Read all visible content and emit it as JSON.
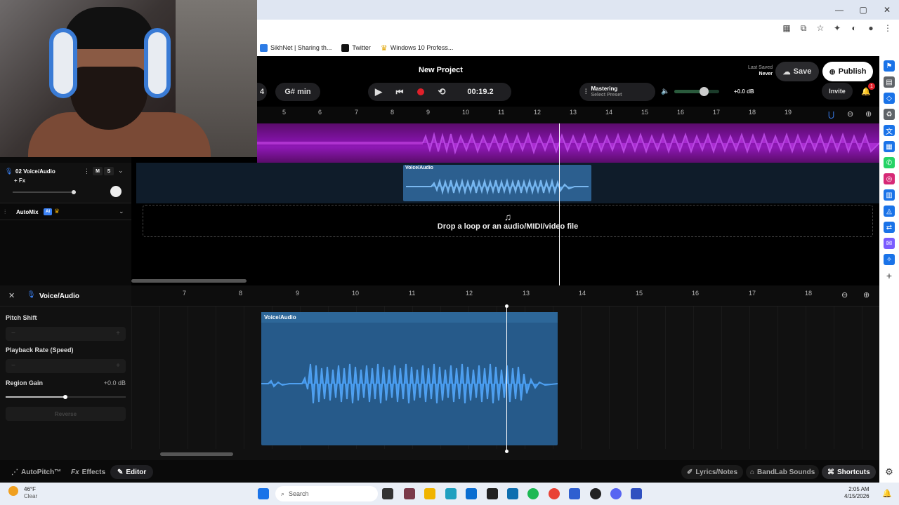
{
  "browser": {
    "window_controls": [
      "—",
      "▢",
      "✕"
    ],
    "bookmarks": [
      {
        "label": "SikhNet | Sharing th...",
        "icon": "sikhnet-icon",
        "color": "#2c7be5"
      },
      {
        "label": "Twitter",
        "icon": "x-twitter-icon",
        "color": "#111111"
      },
      {
        "label": "Windows 10 Profess...",
        "icon": "crown-icon",
        "color": "#e0a400"
      }
    ]
  },
  "toolbar": {
    "project_title": "New Project",
    "key_partial": "4",
    "key": "G# min",
    "time": "00:19.2",
    "mastering_label": "Mastering",
    "mastering_preset": "Select Preset",
    "volume_db": "+0.0 dB",
    "last_saved_label": "Last Saved",
    "last_saved_value": "Never",
    "save_label": "Save",
    "publish_label": "Publish",
    "invite_label": "Invite",
    "notif_count": "1"
  },
  "ruler_top": [
    "5",
    "6",
    "7",
    "8",
    "9",
    "10",
    "11",
    "12",
    "13",
    "14",
    "15",
    "16",
    "17",
    "18",
    "19"
  ],
  "tracks": {
    "track2_name": "02 Voice/Audio",
    "track2_fx": "+ Fx",
    "mute": "M",
    "solo": "S",
    "automix": "AutoMix",
    "ai_badge": "AI",
    "clip_small_title": "Voice/Audio",
    "drop_text": "Drop a loop or an audio/MIDI/video file"
  },
  "editor": {
    "title": "Voice/Audio",
    "ruler": [
      "7",
      "8",
      "9",
      "10",
      "11",
      "12",
      "13",
      "14",
      "15",
      "16",
      "17",
      "18"
    ],
    "pitch_shift": "Pitch Shift",
    "playback_rate": "Playback Rate (Speed)",
    "region_gain": "Region Gain",
    "region_gain_value": "+0.0 dB",
    "reverse": "Reverse",
    "clip_title": "Voice/Audio",
    "minus": "−",
    "plus": "+"
  },
  "bottom": {
    "autopitch": "AutoPitch™",
    "effects": "Effects",
    "editor": "Editor",
    "lyrics": "Lyrics/Notes",
    "sounds": "BandLab Sounds",
    "shortcuts": "Shortcuts"
  },
  "taskbar": {
    "temp": "46°F",
    "weather": "Clear",
    "search": "Search",
    "time": "2:05 AM",
    "date": "4/15/2026"
  },
  "colors": {
    "accent_purple": "#8e18b5",
    "clip_blue": "#2c5f8f",
    "record_red": "#e0202a"
  }
}
